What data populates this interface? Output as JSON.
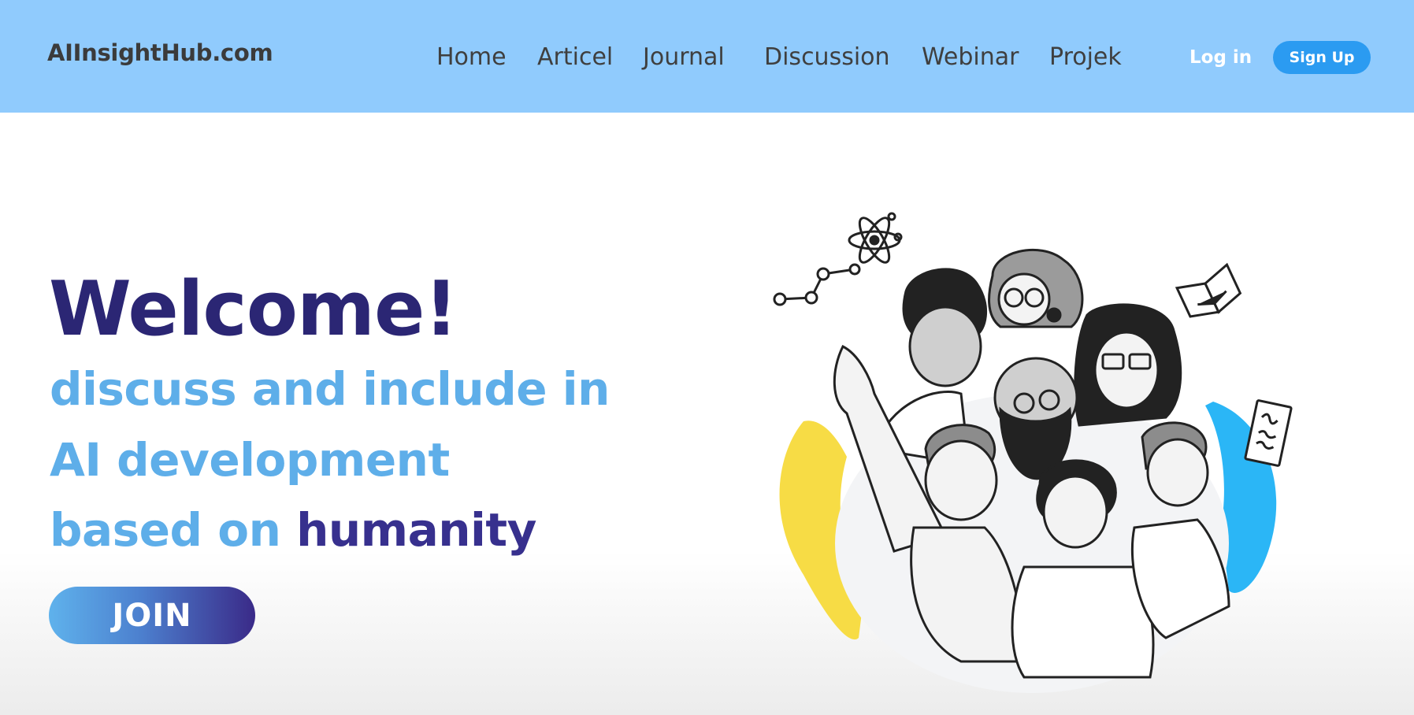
{
  "header": {
    "brand": "AIInsightHub.com",
    "nav": [
      "Home",
      "Articel",
      "Journal",
      "Discussion",
      "Webinar",
      "Projek"
    ],
    "login_label": "Log in",
    "signup_label": "Sign Up"
  },
  "hero": {
    "title": "Welcome!",
    "line1": "discuss and include in",
    "line2": "AI development",
    "line3_prefix": "based on ",
    "line3_accent": "humanity",
    "join_label": "JOIN"
  },
  "colors": {
    "navbar": "#90cbfd",
    "title": "#2b2674",
    "subtitle": "#5eaee9",
    "accent": "#37308e",
    "signup": "#2b9bf1",
    "blob_yellow": "#f7dc45",
    "blob_blue": "#2bb6f6"
  },
  "illustration": {
    "icons": [
      "atom-icon",
      "molecule-icon",
      "open-book-icon",
      "document-icon"
    ]
  }
}
